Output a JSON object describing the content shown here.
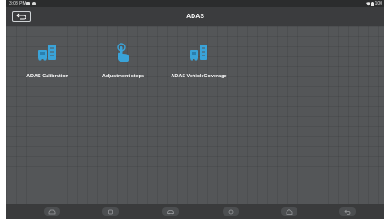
{
  "status_bar": {
    "time": "3:08 PM",
    "battery": "100"
  },
  "header": {
    "title": "ADAS"
  },
  "functions": [
    {
      "label": "ADAS Calibration",
      "icon": "car-calibration-icon"
    },
    {
      "label": "Adjustment steps",
      "icon": "hand-tap-icon"
    },
    {
      "label": "ADAS VehicleCoverage",
      "icon": "car-coverage-icon"
    }
  ],
  "navbar": {
    "buttons": [
      "car-scan-icon",
      "vci-icon",
      "car-icon",
      "screenshot-icon",
      "home-icon",
      "back-icon"
    ]
  },
  "colors": {
    "accent": "#3aa3d8",
    "background": "#545658",
    "header": "#3b3c3e"
  }
}
